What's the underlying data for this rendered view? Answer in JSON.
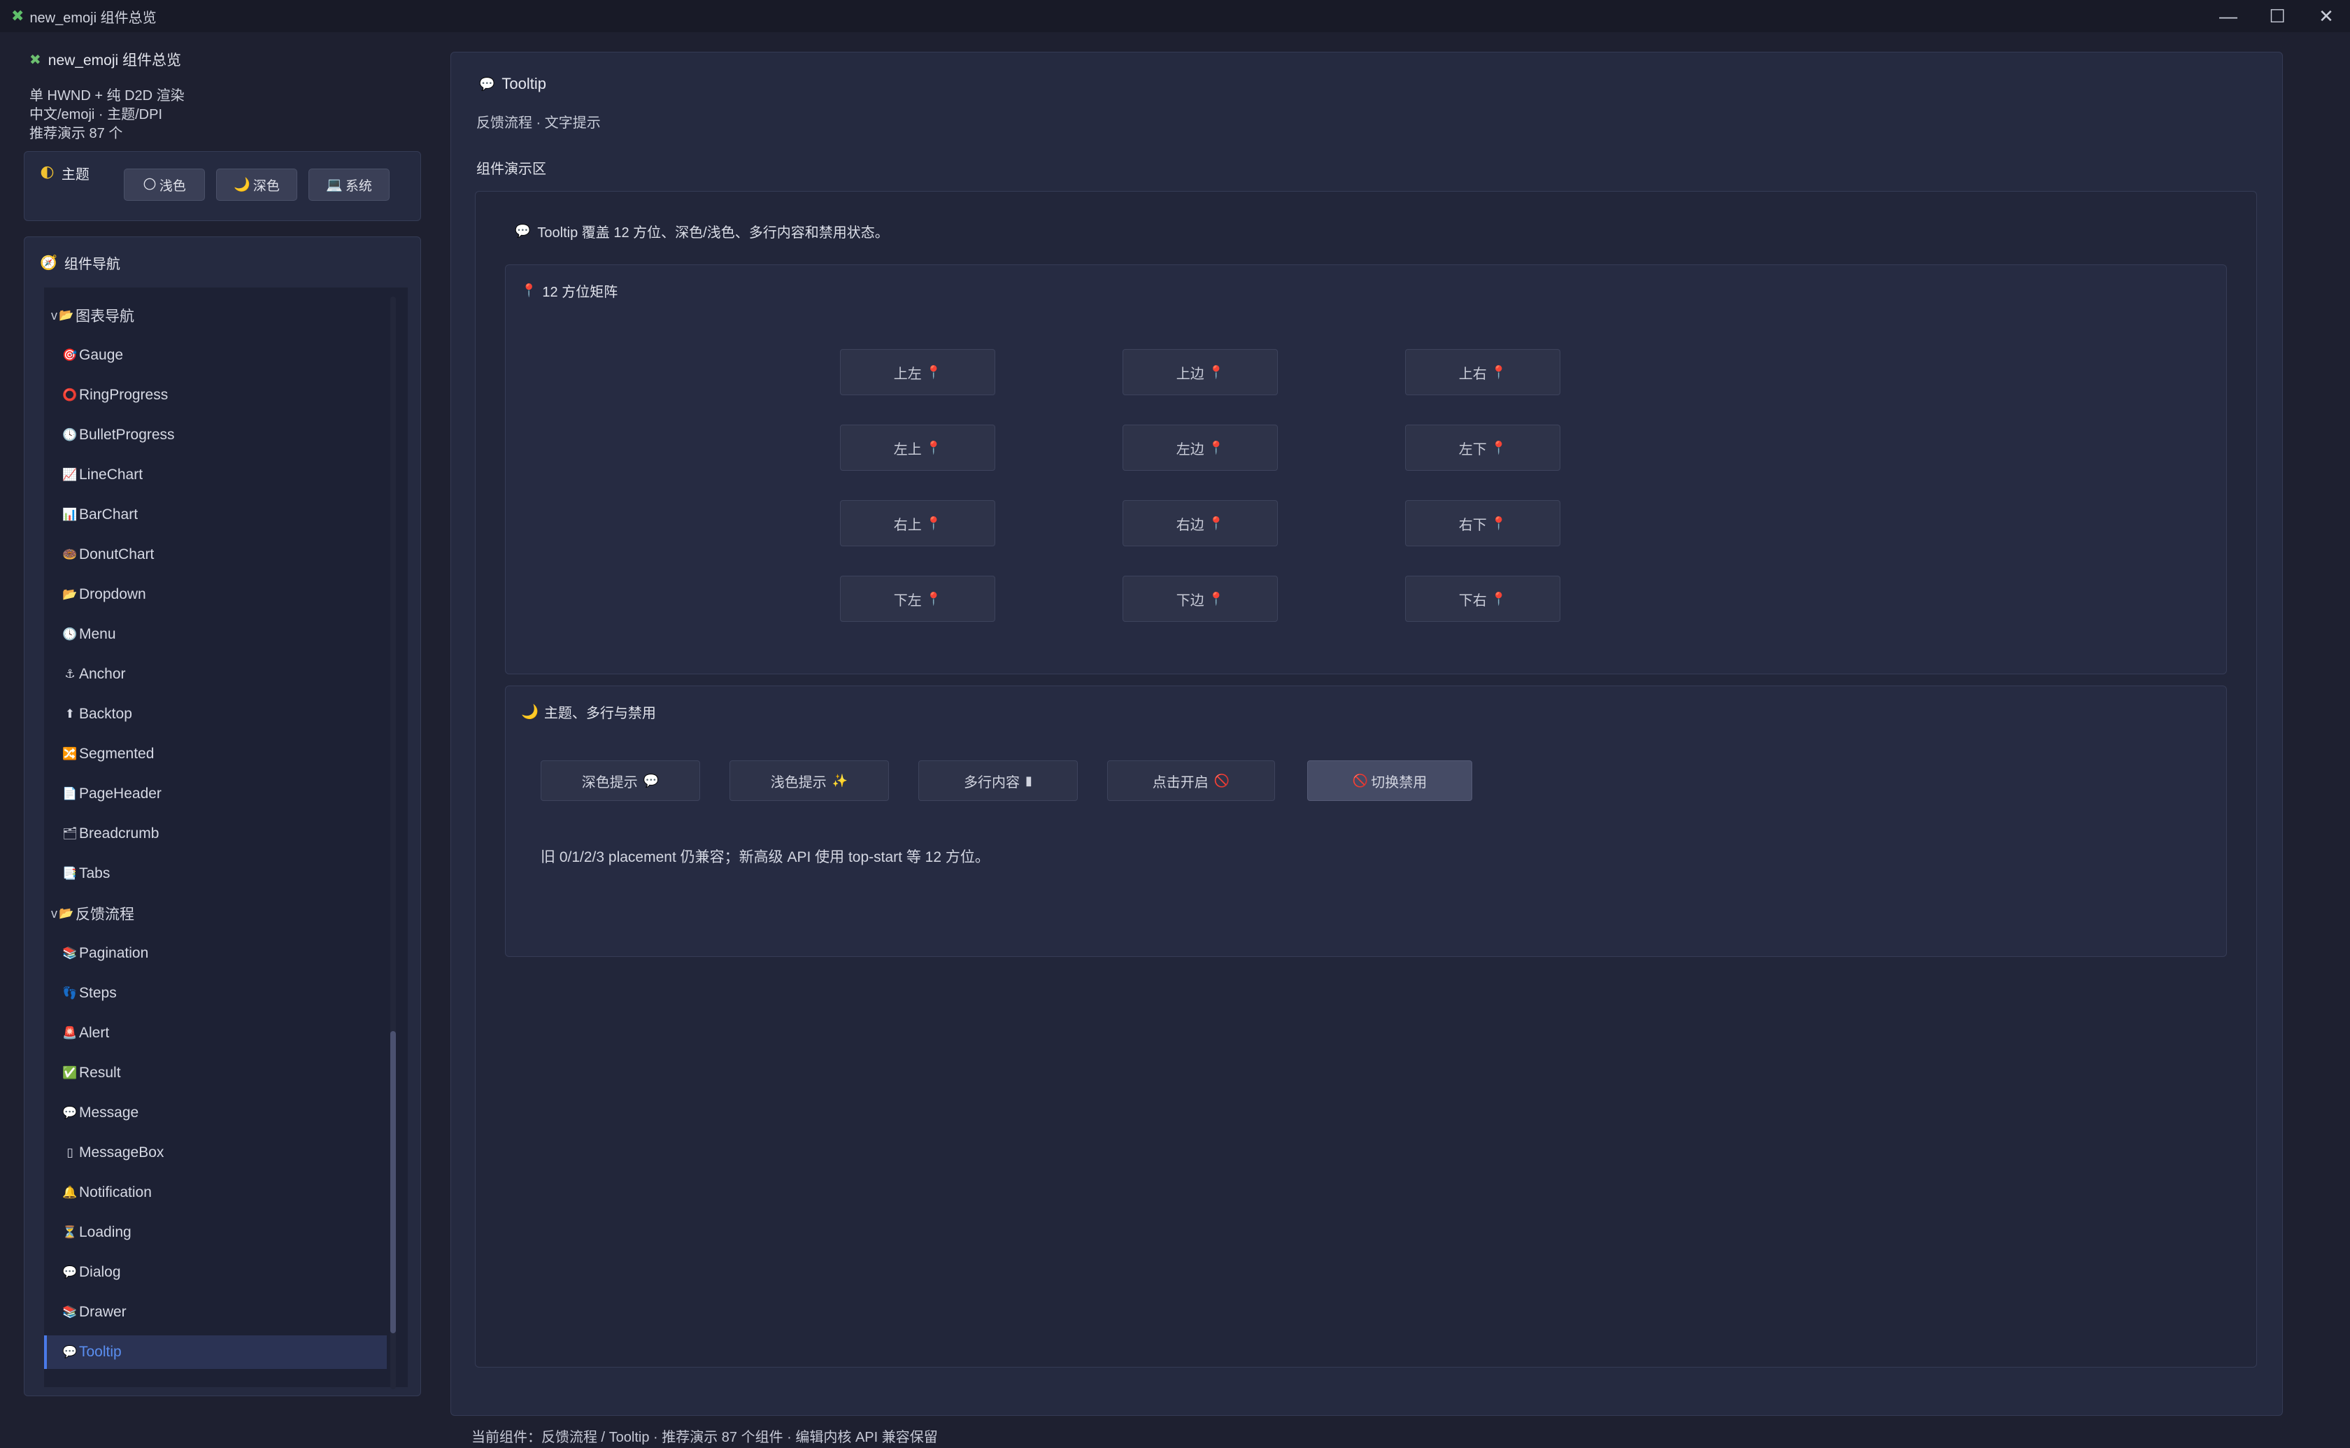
{
  "window": {
    "title": "new_emoji 组件总览",
    "controls": {
      "minimize": "—",
      "maximize": "☐",
      "close": "✕"
    }
  },
  "sidebar": {
    "title": "new_emoji 组件总览",
    "info": [
      "单 HWND + 纯 D2D 渲染",
      "中文/emoji · 主题/DPI",
      "推荐演示 87 个"
    ],
    "theme": {
      "label": "主题",
      "buttons": [
        {
          "icon": "🌕",
          "label": "浅色"
        },
        {
          "icon": "🌙",
          "label": "深色"
        },
        {
          "icon": "💻",
          "label": "系统"
        }
      ]
    },
    "nav": {
      "label": "组件导航",
      "items": [
        {
          "type": "group",
          "caret": "v",
          "icon": "📂",
          "label": "图表导航"
        },
        {
          "icon": "🎯",
          "label": "Gauge"
        },
        {
          "icon": "⭕",
          "label": "RingProgress"
        },
        {
          "icon": "🕓",
          "label": "BulletProgress"
        },
        {
          "icon": "📈",
          "label": "LineChart"
        },
        {
          "icon": "📊",
          "label": "BarChart"
        },
        {
          "icon": "🍩",
          "label": "DonutChart"
        },
        {
          "icon": "📂",
          "label": "Dropdown"
        },
        {
          "icon": "🕓",
          "label": "Menu"
        },
        {
          "icon": "⚓",
          "label": "Anchor"
        },
        {
          "icon": "⬆",
          "label": "Backtop"
        },
        {
          "icon": "🔀",
          "label": "Segmented"
        },
        {
          "icon": "📄",
          "label": "PageHeader"
        },
        {
          "icon": "🗂",
          "label": "Breadcrumb"
        },
        {
          "icon": "📑",
          "label": "Tabs"
        },
        {
          "type": "group",
          "caret": "v",
          "icon": "📂",
          "label": "反馈流程"
        },
        {
          "icon": "📚",
          "label": "Pagination"
        },
        {
          "icon": "👣",
          "label": "Steps"
        },
        {
          "icon": "🚨",
          "label": "Alert"
        },
        {
          "icon": "✅",
          "label": "Result"
        },
        {
          "icon": "💬",
          "label": "Message"
        },
        {
          "icon": "▯",
          "label": "MessageBox"
        },
        {
          "icon": "🔔",
          "label": "Notification"
        },
        {
          "icon": "⏳",
          "label": "Loading"
        },
        {
          "icon": "💬",
          "label": "Dialog"
        },
        {
          "icon": "📚",
          "label": "Drawer"
        },
        {
          "icon": "💬",
          "label": "Tooltip",
          "active": true
        }
      ]
    }
  },
  "main": {
    "title_icon": "💬",
    "title": "Tooltip",
    "subtitle": "反馈流程 · 文字提示",
    "demo_label": "组件演示区",
    "intro_icon": "💬",
    "intro": "Tooltip 覆盖 12 方位、深色/浅色、多行内容和禁用状态。",
    "section1": {
      "icon": "📍",
      "title": "12 方位矩阵",
      "pin": "📍",
      "rows": [
        [
          "上左",
          "上边",
          "上右"
        ],
        [
          "左上",
          "左边",
          "左下"
        ],
        [
          "右上",
          "右边",
          "右下"
        ],
        [
          "下左",
          "下边",
          "下右"
        ]
      ]
    },
    "section2": {
      "icon": "🌙",
      "title": "主题、多行与禁用",
      "buttons": [
        {
          "label": "深色提示",
          "icon": "💬"
        },
        {
          "label": "浅色提示",
          "icon": "✨"
        },
        {
          "label": "多行内容",
          "icon": "▮"
        },
        {
          "label": "点击开启",
          "icon": "🚫"
        },
        {
          "label": "切换禁用",
          "icon": "🚫",
          "pressed": true
        }
      ],
      "note": "旧 0/1/2/3 placement 仍兼容；新高级 API 使用 top-start 等 12 方位。"
    }
  },
  "status": "当前组件：反馈流程 / Tooltip · 推荐演示 87 个组件 · 编辑内核 API 兼容保留"
}
